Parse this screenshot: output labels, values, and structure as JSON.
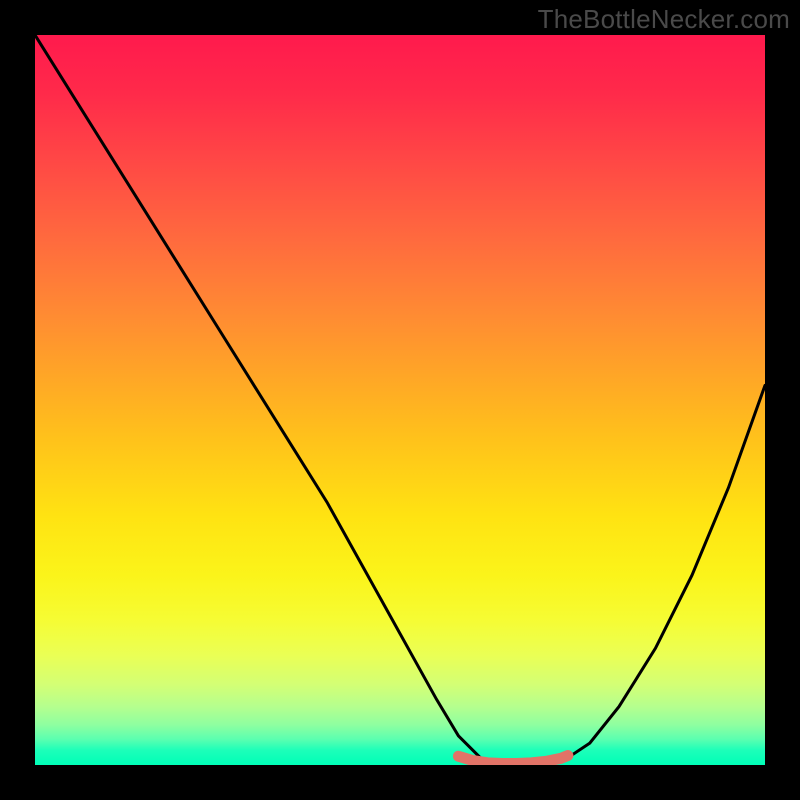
{
  "watermark": "TheBottleNecker.com",
  "chart_data": {
    "type": "line",
    "title": "",
    "xlabel": "",
    "ylabel": "",
    "xlim": [
      0,
      100
    ],
    "ylim": [
      0,
      100
    ],
    "series": [
      {
        "name": "bottleneck-curve",
        "color": "#000000",
        "x": [
          0,
          5,
          10,
          15,
          20,
          25,
          30,
          35,
          40,
          45,
          50,
          55,
          58,
          61,
          64,
          67,
          70,
          73,
          76,
          80,
          85,
          90,
          95,
          100
        ],
        "y": [
          100,
          92,
          84,
          76,
          68,
          60,
          52,
          44,
          36,
          27,
          18,
          9,
          4,
          1,
          0,
          0,
          0,
          1,
          3,
          8,
          16,
          26,
          38,
          52
        ]
      },
      {
        "name": "optimal-flat-region",
        "color": "#e17367",
        "x": [
          58,
          60,
          62,
          64,
          66,
          68,
          70,
          72,
          73
        ],
        "y": [
          1.2,
          0.6,
          0.3,
          0.2,
          0.2,
          0.3,
          0.5,
          0.9,
          1.3
        ]
      }
    ],
    "background_gradient": {
      "top_color": "#ff1a4d",
      "mid_color": "#ffe312",
      "bottom_color": "#00ffb8"
    }
  }
}
